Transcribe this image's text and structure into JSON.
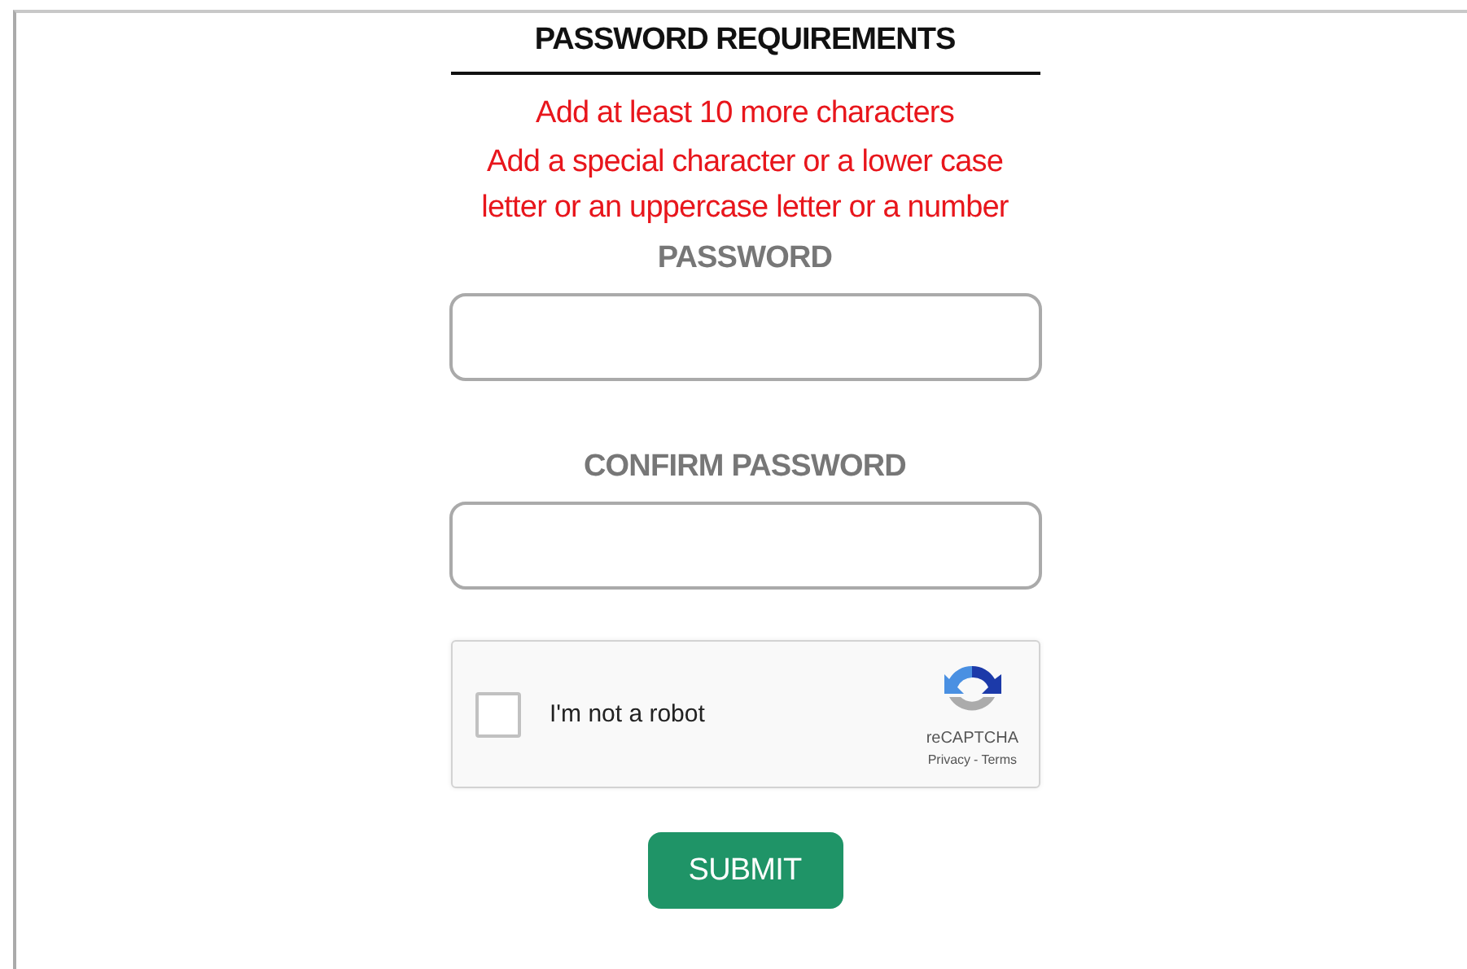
{
  "title": "PASSWORD REQUIREMENTS",
  "requirements": [
    "Add at least 10 more characters",
    "Add a special character or a lower case letter or an uppercase letter or a number"
  ],
  "fields": [
    {
      "label": "PASSWORD"
    },
    {
      "label": "CONFIRM PASSWORD"
    }
  ],
  "captcha": {
    "label": "I'm not a robot",
    "checked": false,
    "brand": "reCAPTCHA",
    "privacy": "Privacy",
    "separator": "-",
    "terms": "Terms"
  },
  "submit": "SUBMIT"
}
